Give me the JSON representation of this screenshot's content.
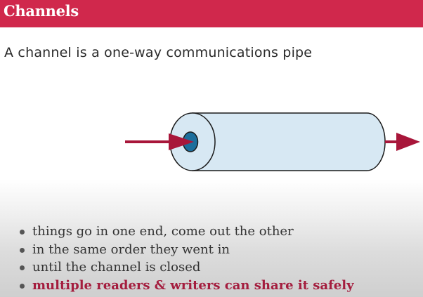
{
  "slide": {
    "title": "Channels",
    "subtitle": "A channel is a one-way communications pipe",
    "bullets": [
      {
        "text": "things go in one end, come out the other",
        "emphasis": false
      },
      {
        "text": "in the same order they went in",
        "emphasis": false
      },
      {
        "text": "until the channel is closed",
        "emphasis": false
      },
      {
        "text": "multiple readers & writers can share it safely",
        "emphasis": true
      }
    ]
  },
  "colors": {
    "title_bar": "#d0284c",
    "arrow": "#a8163a",
    "pipe_fill": "#d7e8f3",
    "pipe_opening": "#1c6e9c",
    "emphasis_text": "#a41d3e"
  }
}
